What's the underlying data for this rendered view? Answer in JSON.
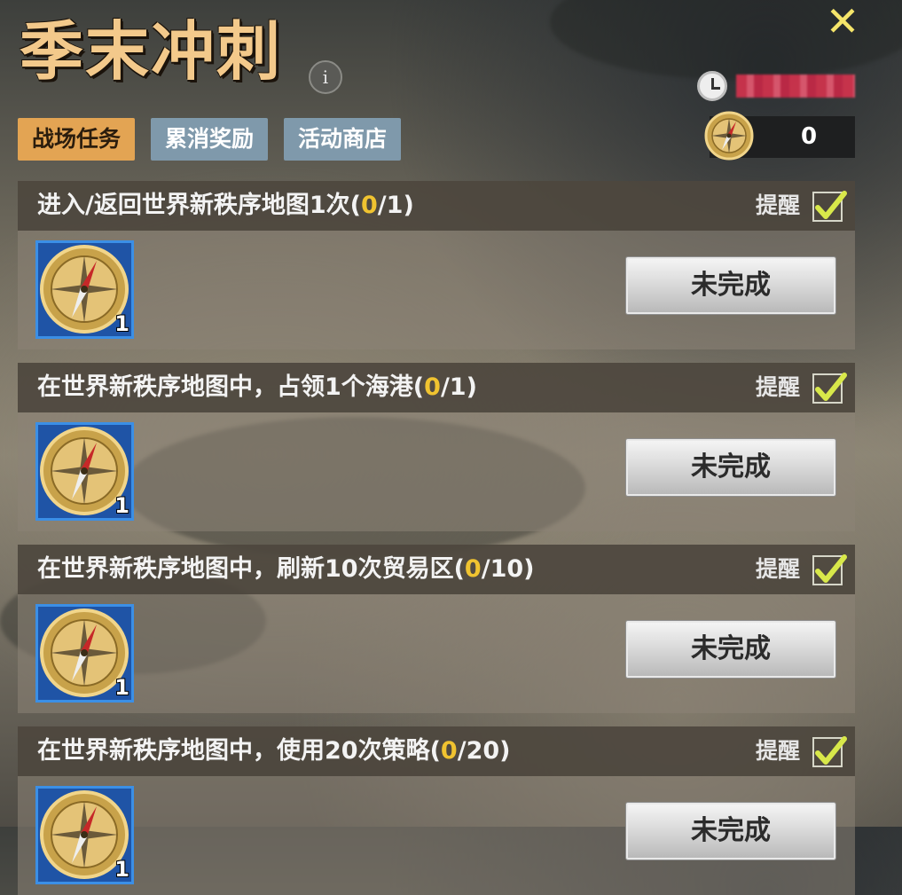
{
  "header": {
    "title": "季末冲刺",
    "info_icon": "info-icon",
    "info_glyph": "i",
    "close_icon": "close-icon",
    "close_glyph": "✕",
    "timer_icon": "clock-icon",
    "timer_text": ""
  },
  "tabs": [
    {
      "label": "战场任务",
      "active": true
    },
    {
      "label": "累消奖励",
      "active": false
    },
    {
      "label": "活动商店",
      "active": false
    }
  ],
  "currency": {
    "icon": "compass-icon",
    "value": "0"
  },
  "tasks": [
    {
      "title_main": "进入/返回世界新秩序地图1次(",
      "progress_current": "0",
      "progress_rest": "/1)",
      "remind_label": "提醒",
      "remind_checked": true,
      "reward_icon": "compass-icon",
      "reward_count": "1",
      "status_label": "未完成"
    },
    {
      "title_main": "在世界新秩序地图中，占领1个海港(",
      "progress_current": "0",
      "progress_rest": "/1)",
      "remind_label": "提醒",
      "remind_checked": true,
      "reward_icon": "compass-icon",
      "reward_count": "1",
      "status_label": "未完成"
    },
    {
      "title_main": "在世界新秩序地图中，刷新10次贸易区(",
      "progress_current": "0",
      "progress_rest": "/10)",
      "remind_label": "提醒",
      "remind_checked": true,
      "reward_icon": "compass-icon",
      "reward_count": "1",
      "status_label": "未完成"
    },
    {
      "title_main": "在世界新秩序地图中，使用20次策略(",
      "progress_current": "0",
      "progress_rest": "/20)",
      "remind_label": "提醒",
      "remind_checked": true,
      "reward_icon": "compass-icon",
      "reward_count": "1",
      "status_label": "未完成"
    }
  ],
  "colors": {
    "title": "#f3c98b",
    "tab_active": "#e3a453",
    "tab_inactive": "#7f99ab",
    "progress_highlight": "#f0c330",
    "checkmark": "#d8e84a",
    "close": "#f5e56a"
  }
}
